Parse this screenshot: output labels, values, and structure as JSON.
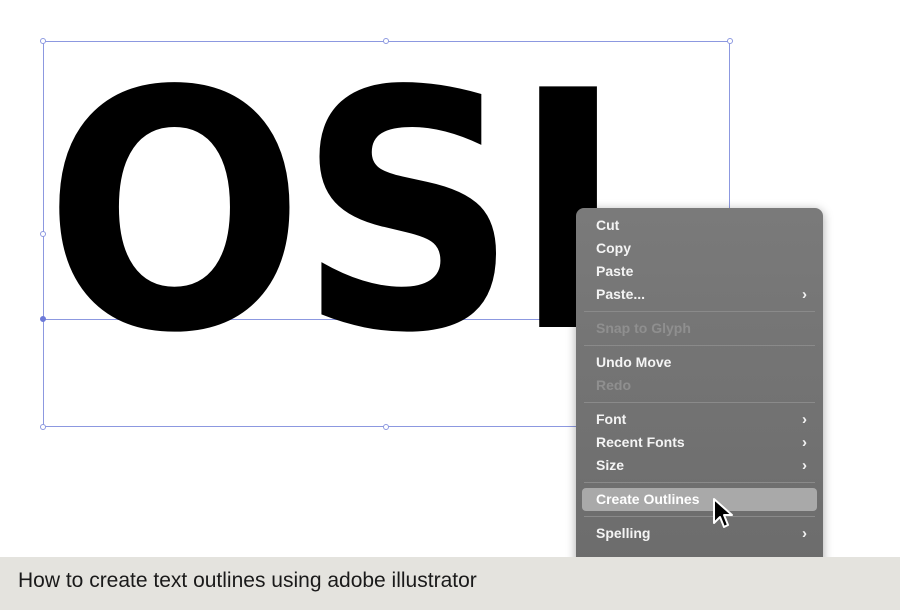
{
  "artwork": {
    "text": "OSL"
  },
  "context_menu": {
    "items": [
      {
        "label": "Cut"
      },
      {
        "label": "Copy"
      },
      {
        "label": "Paste"
      },
      {
        "label": "Paste...",
        "submenu": true
      },
      {
        "label": "Snap to Glyph",
        "disabled": true
      },
      {
        "label": "Undo Move"
      },
      {
        "label": "Redo",
        "disabled": true
      },
      {
        "label": "Font",
        "submenu": true
      },
      {
        "label": "Recent Fonts",
        "submenu": true
      },
      {
        "label": "Size",
        "submenu": true
      },
      {
        "label": "Create Outlines",
        "highlighted": true
      },
      {
        "label": "Spelling",
        "submenu": true
      }
    ],
    "colors": {
      "background": "#6f6f6f",
      "highlight": "#a9a9a9",
      "disabled_text": "#8f8f8f"
    }
  },
  "caption": {
    "text": "How to create text outlines using adobe illustrator"
  },
  "icons": {
    "cursor": "arrow-pointer-icon",
    "submenu": "chevron-right-icon"
  }
}
